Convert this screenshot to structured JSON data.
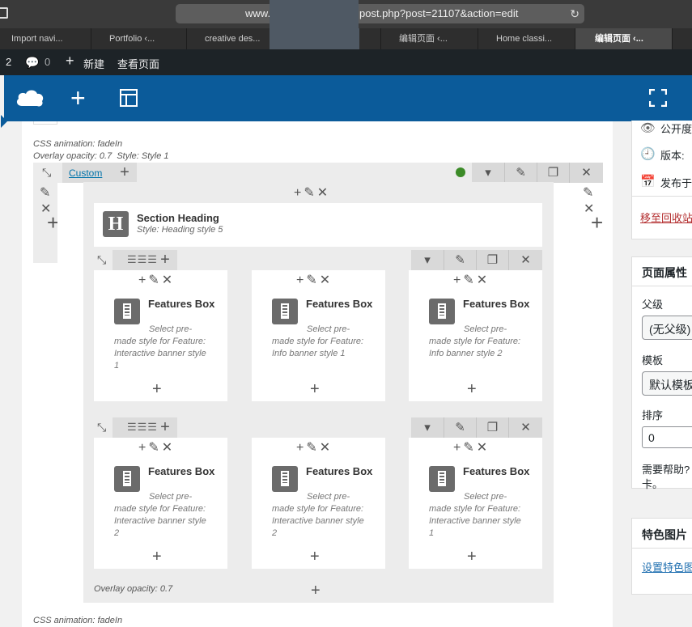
{
  "browser": {
    "url_left": "www.",
    "url_right": "post.php?post=21107&action=edit",
    "tabs": [
      "Import navi...",
      "Portfolio ‹...",
      "creative des...",
      "",
      "编辑页面 ‹...",
      "Home classi...",
      "编辑页面 ‹..."
    ]
  },
  "admin_bar": {
    "updates": "2",
    "comments": "0",
    "new_label": "新建",
    "view_label": "查看页面"
  },
  "builder": {
    "css_animation_top": "CSS animation: fadeIn",
    "overlay_style_top": "Overlay opacity: 0.7  Style: Style 1",
    "custom_link": "Custom",
    "heading_title": "Section Heading",
    "heading_style": "Style: Heading style 5",
    "row1": [
      {
        "title": "Features Box",
        "desc": "Select pre-made style for Feature: Interactive banner style 1"
      },
      {
        "title": "Features Box",
        "desc": "Select pre-made style for Feature: Info banner style 1"
      },
      {
        "title": "Features Box",
        "desc": "Select pre-made style for Feature: Info banner style 2"
      }
    ],
    "row2": [
      {
        "title": "Features Box",
        "desc": "Select pre-made style for Feature: Interactive banner style 2"
      },
      {
        "title": "Features Box",
        "desc": "Select pre-made style for Feature: Interactive banner style 2"
      },
      {
        "title": "Features Box",
        "desc": "Select pre-made style for Feature: Interactive banner style 1"
      }
    ],
    "overlay_inner": "Overlay opacity: 0.7",
    "css_animation_bottom": "CSS animation: fadeIn"
  },
  "sidebar": {
    "visibility": "公开度",
    "revisions": "版本:",
    "publish": "发布于",
    "trash": "移至回收站",
    "page_attributes": "页面属性",
    "parent_label": "父级",
    "parent_value": "(无父级)",
    "template_label": "模板",
    "template_value": "默认模板",
    "order_label": "排序",
    "order_value": "0",
    "help": "需要帮助?",
    "help2": "卡。",
    "featured_image": "特色图片",
    "set_featured": "设置特色图"
  }
}
